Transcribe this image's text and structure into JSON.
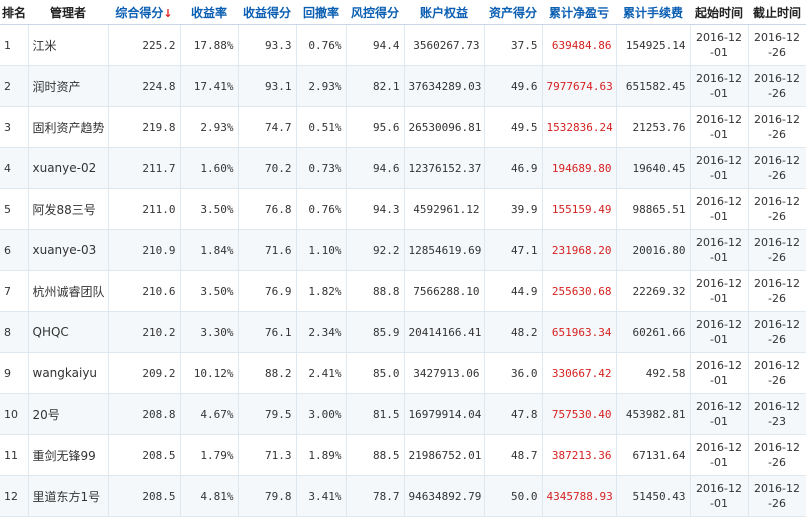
{
  "columns": {
    "rank": "排名",
    "manager": "管理者",
    "score": "综合得分",
    "return_rate": "收益率",
    "return_score": "收益得分",
    "drawdown": "回撤率",
    "risk_score": "风控得分",
    "equity": "账户权益",
    "asset_score": "资产得分",
    "cum_profit": "累计净盈亏",
    "cum_fee": "累计手续费",
    "start": "起始时间",
    "end": "截止时间"
  },
  "sort_indicator": "↓",
  "colors": {
    "header_link": "#0b5fb3",
    "profit": "#d62020",
    "sort_arrow": "#e02020"
  },
  "rows": [
    {
      "rank": "1",
      "manager": "江米",
      "score": "225.2",
      "return_rate": "17.88%",
      "return_score": "93.3",
      "drawdown": "0.76%",
      "risk_score": "94.4",
      "equity": "3560267.73",
      "asset_score": "37.5",
      "cum_profit": "639484.86",
      "cum_fee": "154925.14",
      "start": "2016-12-01",
      "end": "2016-12-26"
    },
    {
      "rank": "2",
      "manager": "润时资产",
      "score": "224.8",
      "return_rate": "17.41%",
      "return_score": "93.1",
      "drawdown": "2.93%",
      "risk_score": "82.1",
      "equity": "37634289.03",
      "asset_score": "49.6",
      "cum_profit": "7977674.63",
      "cum_fee": "651582.45",
      "start": "2016-12-01",
      "end": "2016-12-26"
    },
    {
      "rank": "3",
      "manager": "固利资产趋势",
      "score": "219.8",
      "return_rate": "2.93%",
      "return_score": "74.7",
      "drawdown": "0.51%",
      "risk_score": "95.6",
      "equity": "26530096.81",
      "asset_score": "49.5",
      "cum_profit": "1532836.24",
      "cum_fee": "21253.76",
      "start": "2016-12-01",
      "end": "2016-12-26"
    },
    {
      "rank": "4",
      "manager": "xuanye-02",
      "score": "211.7",
      "return_rate": "1.60%",
      "return_score": "70.2",
      "drawdown": "0.73%",
      "risk_score": "94.6",
      "equity": "12376152.37",
      "asset_score": "46.9",
      "cum_profit": "194689.80",
      "cum_fee": "19640.45",
      "start": "2016-12-01",
      "end": "2016-12-26"
    },
    {
      "rank": "5",
      "manager": "阿发88三号",
      "score": "211.0",
      "return_rate": "3.50%",
      "return_score": "76.8",
      "drawdown": "0.76%",
      "risk_score": "94.3",
      "equity": "4592961.12",
      "asset_score": "39.9",
      "cum_profit": "155159.49",
      "cum_fee": "98865.51",
      "start": "2016-12-01",
      "end": "2016-12-26"
    },
    {
      "rank": "6",
      "manager": "xuanye-03",
      "score": "210.9",
      "return_rate": "1.84%",
      "return_score": "71.6",
      "drawdown": "1.10%",
      "risk_score": "92.2",
      "equity": "12854619.69",
      "asset_score": "47.1",
      "cum_profit": "231968.20",
      "cum_fee": "20016.80",
      "start": "2016-12-01",
      "end": "2016-12-26"
    },
    {
      "rank": "7",
      "manager": "杭州诚睿团队",
      "score": "210.6",
      "return_rate": "3.50%",
      "return_score": "76.9",
      "drawdown": "1.82%",
      "risk_score": "88.8",
      "equity": "7566288.10",
      "asset_score": "44.9",
      "cum_profit": "255630.68",
      "cum_fee": "22269.32",
      "start": "2016-12-01",
      "end": "2016-12-26"
    },
    {
      "rank": "8",
      "manager": "QHQC",
      "score": "210.2",
      "return_rate": "3.30%",
      "return_score": "76.1",
      "drawdown": "2.34%",
      "risk_score": "85.9",
      "equity": "20414166.41",
      "asset_score": "48.2",
      "cum_profit": "651963.34",
      "cum_fee": "60261.66",
      "start": "2016-12-01",
      "end": "2016-12-26"
    },
    {
      "rank": "9",
      "manager": "wangkaiyu",
      "score": "209.2",
      "return_rate": "10.12%",
      "return_score": "88.2",
      "drawdown": "2.41%",
      "risk_score": "85.0",
      "equity": "3427913.06",
      "asset_score": "36.0",
      "cum_profit": "330667.42",
      "cum_fee": "492.58",
      "start": "2016-12-01",
      "end": "2016-12-26"
    },
    {
      "rank": "10",
      "manager": "20号",
      "score": "208.8",
      "return_rate": "4.67%",
      "return_score": "79.5",
      "drawdown": "3.00%",
      "risk_score": "81.5",
      "equity": "16979914.04",
      "asset_score": "47.8",
      "cum_profit": "757530.40",
      "cum_fee": "453982.81",
      "start": "2016-12-01",
      "end": "2016-12-23"
    },
    {
      "rank": "11",
      "manager": "重剑无锋99",
      "score": "208.5",
      "return_rate": "1.79%",
      "return_score": "71.3",
      "drawdown": "1.89%",
      "risk_score": "88.5",
      "equity": "21986752.01",
      "asset_score": "48.7",
      "cum_profit": "387213.36",
      "cum_fee": "67131.64",
      "start": "2016-12-01",
      "end": "2016-12-26"
    },
    {
      "rank": "12",
      "manager": "里道东方1号",
      "score": "208.5",
      "return_rate": "4.81%",
      "return_score": "79.8",
      "drawdown": "3.41%",
      "risk_score": "78.7",
      "equity": "94634892.79",
      "asset_score": "50.0",
      "cum_profit": "4345788.93",
      "cum_fee": "51450.43",
      "start": "2016-12-01",
      "end": "2016-12-26"
    }
  ]
}
